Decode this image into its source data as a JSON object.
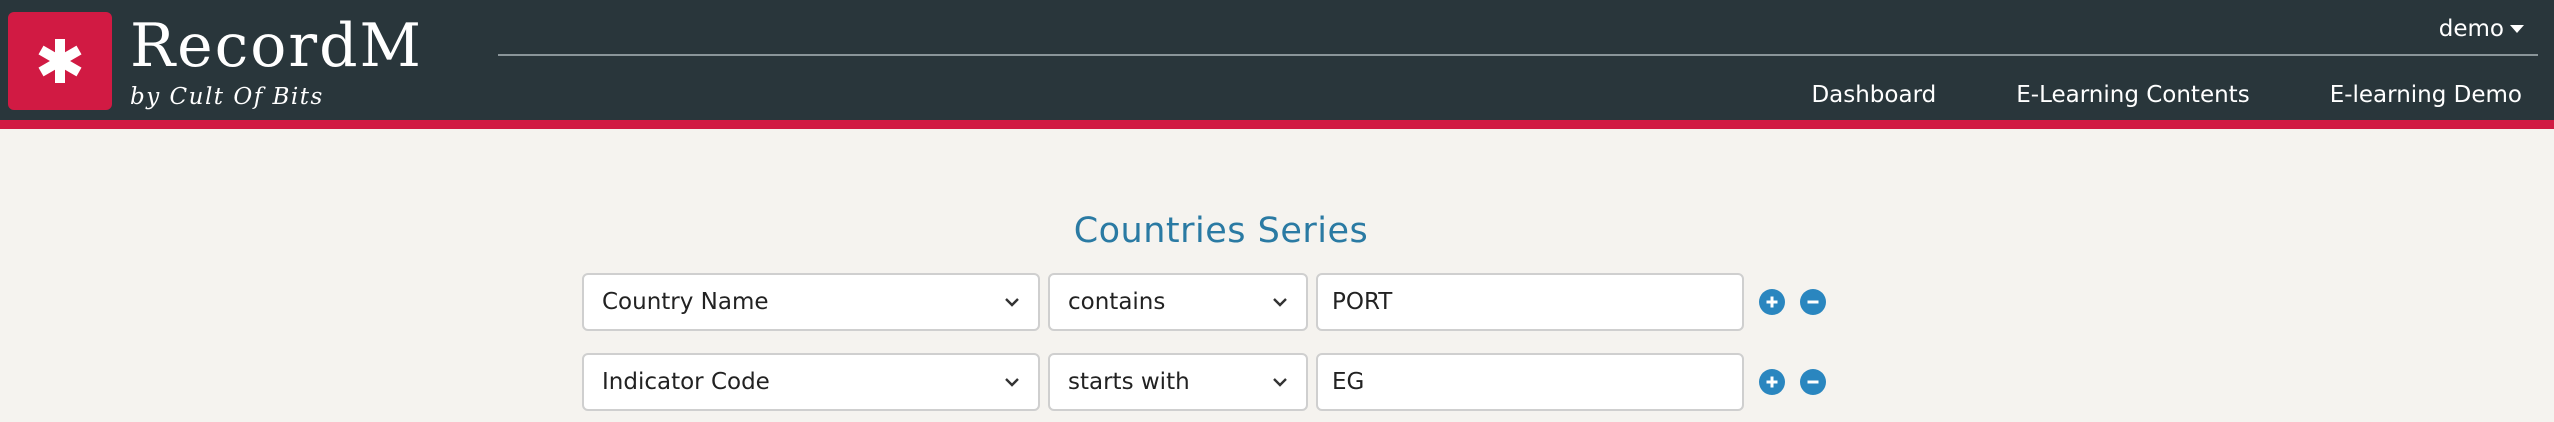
{
  "brand": {
    "name": "RecordM",
    "subtitle": "by Cult Of Bits"
  },
  "user_menu": {
    "label": "demo"
  },
  "nav": {
    "items": [
      {
        "label": "Dashboard"
      },
      {
        "label": "E-Learning Contents"
      },
      {
        "label": "E-learning Demo"
      }
    ]
  },
  "page": {
    "title": "Countries Series"
  },
  "filters": [
    {
      "field": "Country Name",
      "operator": "contains",
      "value": "PORT"
    },
    {
      "field": "Indicator Code",
      "operator": "starts with",
      "value": "EG"
    }
  ],
  "colors": {
    "header_bg": "#29363b",
    "accent": "#d11a43",
    "title": "#2a7aa3",
    "button": "#2a86bf",
    "page_bg": "#f5f3ef"
  },
  "icons": {
    "logo": "asterisk-icon",
    "user_caret": "caret-down-icon",
    "select_chevron": "chevron-down-icon",
    "add": "plus-circle-icon",
    "remove": "minus-circle-icon"
  }
}
